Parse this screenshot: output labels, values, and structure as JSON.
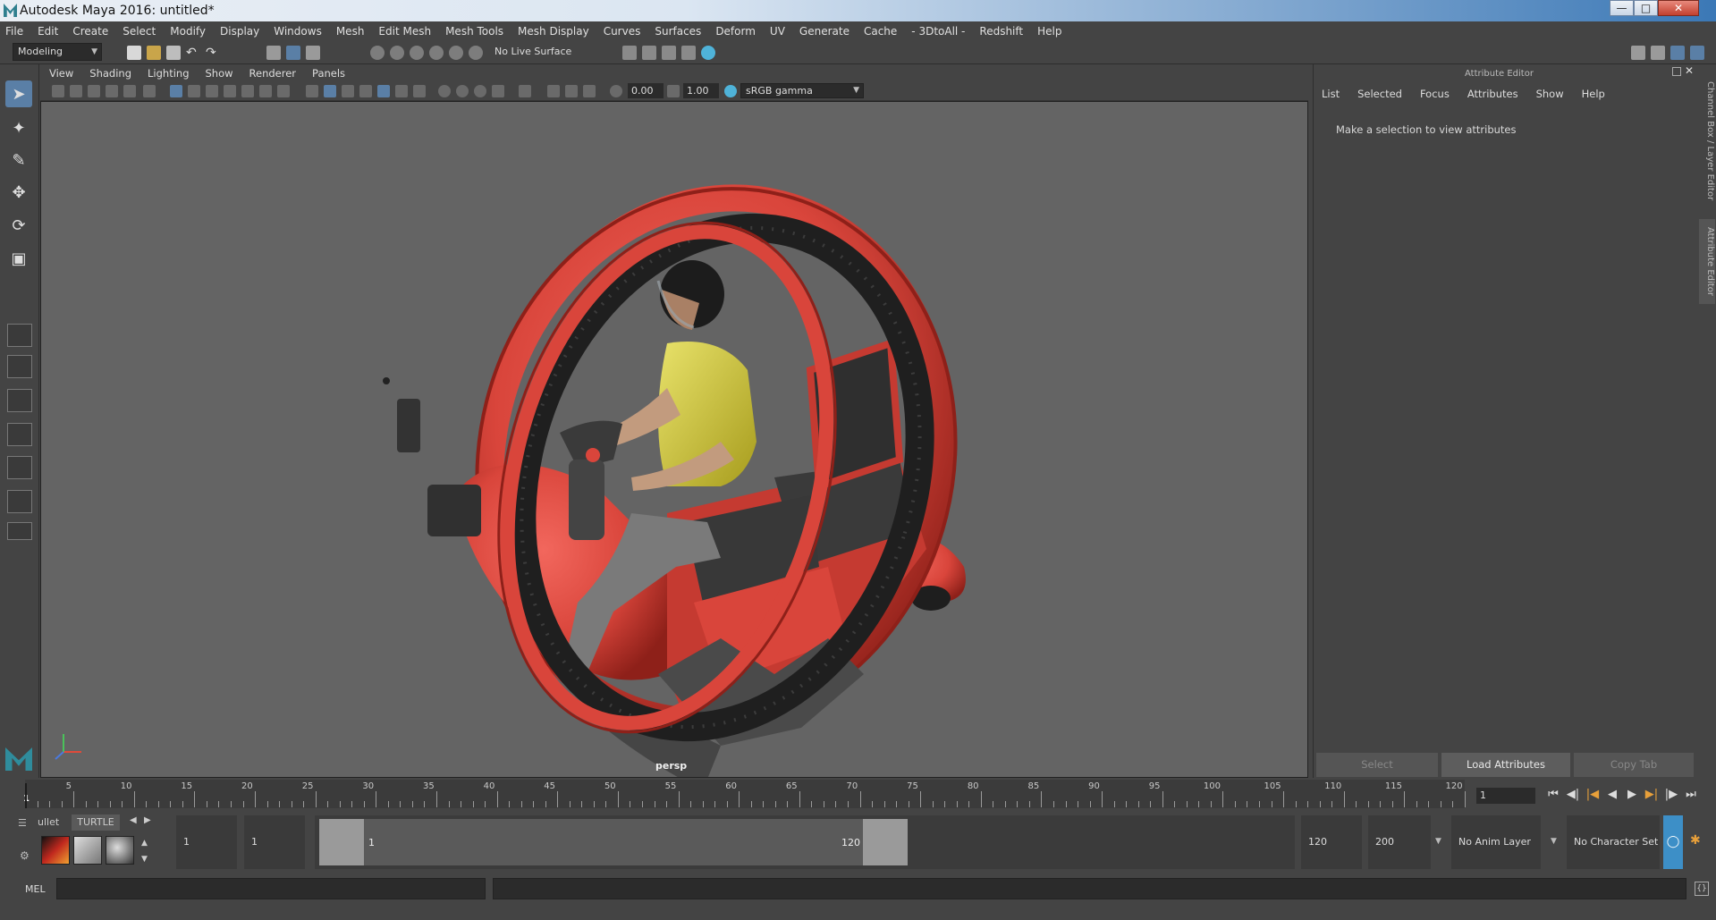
{
  "window": {
    "title": "Autodesk Maya 2016: untitled*",
    "minimize_icon": "minimize-icon",
    "maximize_icon": "maximize-icon",
    "close_icon": "close-icon"
  },
  "menubar": {
    "items": [
      "File",
      "Edit",
      "Create",
      "Select",
      "Modify",
      "Display",
      "Windows",
      "Mesh",
      "Edit Mesh",
      "Mesh Tools",
      "Mesh Display",
      "Curves",
      "Surfaces",
      "Deform",
      "UV",
      "Generate",
      "Cache",
      "- 3DtoAll -",
      "Redshift",
      "Help"
    ]
  },
  "statusline": {
    "menu_set": "Modeling",
    "live_surface": "No Live Surface"
  },
  "viewport": {
    "panel_menu": [
      "View",
      "Shading",
      "Lighting",
      "Show",
      "Renderer",
      "Panels"
    ],
    "exposure": "0.00",
    "gamma": "1.00",
    "color_space": "sRGB gamma",
    "camera_label": "persp"
  },
  "attribute_editor": {
    "title": "Attribute Editor",
    "menu": [
      "List",
      "Selected",
      "Focus",
      "Attributes",
      "Show",
      "Help"
    ],
    "message": "Make a selection to view attributes",
    "buttons": {
      "select": "Select",
      "load": "Load Attributes",
      "copy": "Copy Tab"
    },
    "side_tabs": {
      "channel_box": "Channel Box / Layer Editor",
      "attribute_editor": "Attribute Editor"
    }
  },
  "timeline": {
    "ticks": [
      5,
      10,
      15,
      20,
      25,
      30,
      35,
      40,
      45,
      50,
      55,
      60,
      65,
      70,
      75,
      80,
      85,
      90,
      95,
      100,
      105,
      110,
      115,
      120
    ],
    "start_label": "1",
    "current_frame": "1"
  },
  "range": {
    "shelf_tabs": {
      "tab1": "ullet",
      "tab2": "TURTLE"
    },
    "start_frame": "1",
    "playback_start": "1",
    "range_start_label": "1",
    "range_end_label": "120",
    "playback_end": "120",
    "end_frame": "200",
    "anim_layer": "No Anim Layer",
    "character_set": "No Character Set"
  },
  "command_line": {
    "label": "MEL"
  },
  "colors": {
    "accent": "#5a7fa6",
    "viewport_bg": "#646464",
    "ui_bg": "#444444",
    "field_bg": "#2b2b2b",
    "monowheel_red": "#d9453b"
  }
}
